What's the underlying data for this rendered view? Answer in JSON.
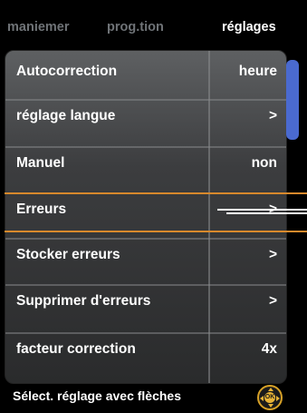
{
  "tabs": [
    {
      "label": "maniemer",
      "active": false
    },
    {
      "label": "prog.tion",
      "active": false
    },
    {
      "label": "réglages",
      "active": true
    }
  ],
  "menu": {
    "items": [
      {
        "label": "Autocorrection",
        "value": "heure"
      },
      {
        "label": "réglage langue",
        "value": ">"
      },
      {
        "label": "Manuel",
        "value": "non"
      },
      {
        "label": "Erreurs",
        "value": ">",
        "selected": true
      },
      {
        "label": "Stocker erreurs",
        "value": ">"
      },
      {
        "label": "Supprimer d'erreurs",
        "value": ">"
      },
      {
        "label": "facteur correction",
        "value": "4x"
      }
    ]
  },
  "footer": {
    "hint": "Sélect. réglage avec flèches",
    "ok_label": "OK"
  },
  "colors": {
    "accent": "#d8892c",
    "scrollbar": "#4a6ad0",
    "tab_inactive": "#6f7377"
  },
  "icons": {
    "dpad": "dpad-ok-icon"
  }
}
